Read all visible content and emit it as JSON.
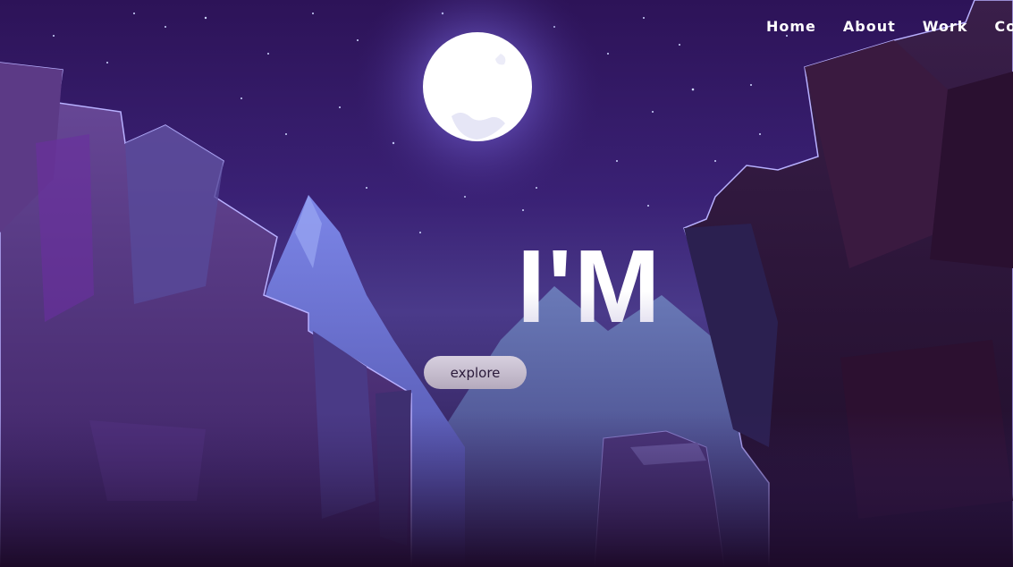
{
  "nav": {
    "items": [
      {
        "label": "Home"
      },
      {
        "label": "About"
      },
      {
        "label": "Work"
      },
      {
        "label": "Con"
      }
    ]
  },
  "hero": {
    "headline": "I'M",
    "cta_label": "explore"
  },
  "colors": {
    "sky_top": "#2d1358",
    "sky_mid": "#3a2175",
    "moon": "#ffffff",
    "moon_glow": "#8d7ff0",
    "mountain": "#6f79d8",
    "cliff_left": "#5b3d8a",
    "cliff_right": "#2a1540",
    "button_bg": "#c8c0d0",
    "button_text": "#2a1a3a"
  }
}
